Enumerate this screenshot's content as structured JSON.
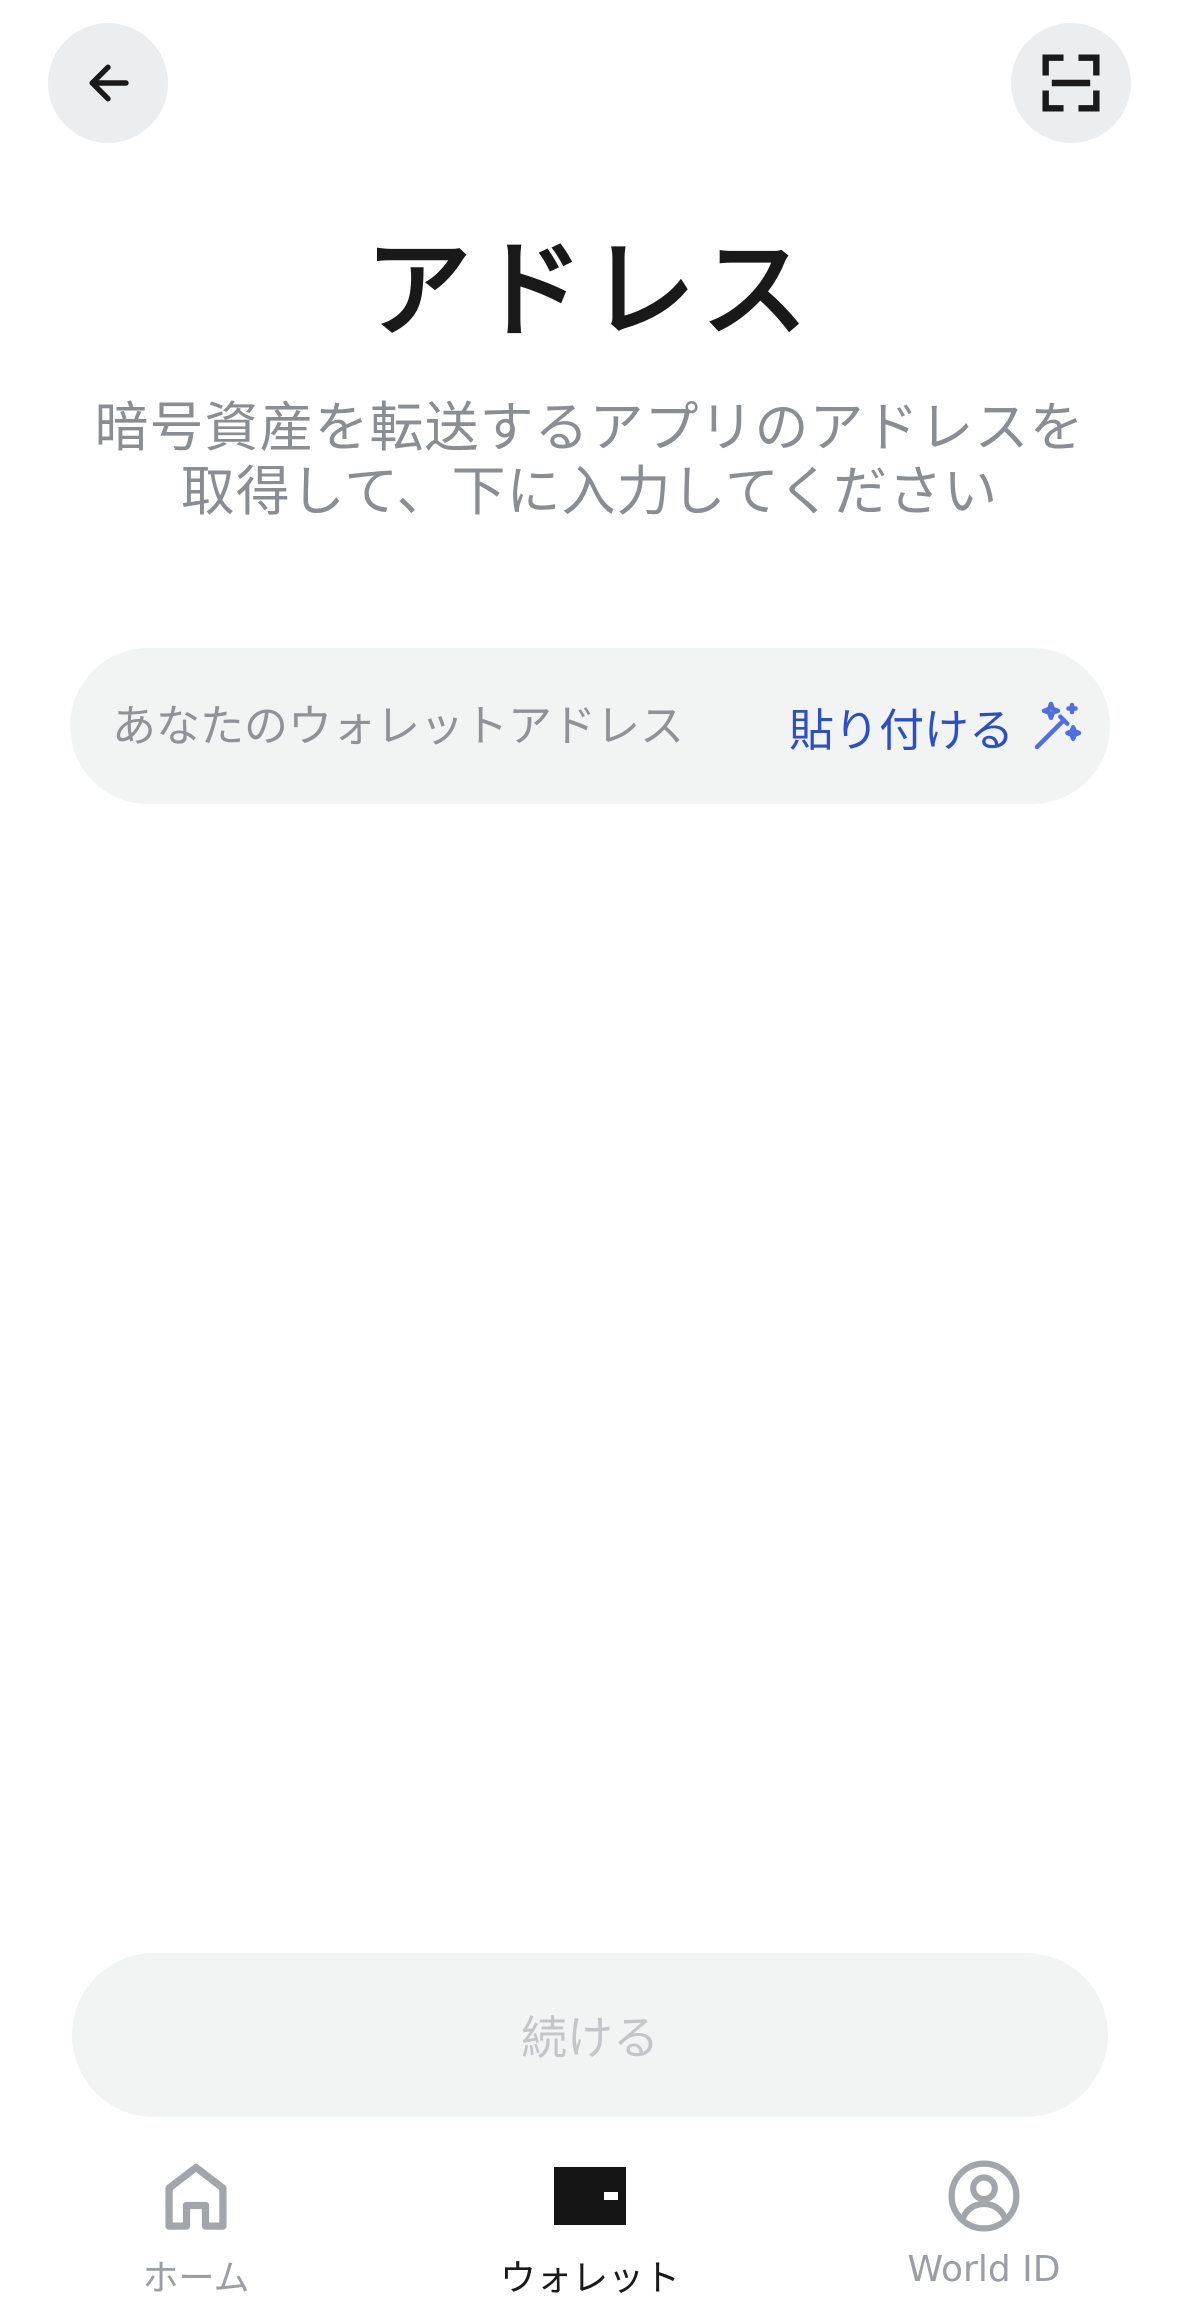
{
  "header": {
    "back_icon": "arrow-left-icon",
    "scan_icon": "scan-frame-icon"
  },
  "page": {
    "title": "アドレス",
    "subtitle_line1": "暗号資産を転送するアプリのアドレスを",
    "subtitle_line2": "取得して、下に入力してください"
  },
  "address_input": {
    "value": "",
    "placeholder": "あなたのウォレットアドレス",
    "paste_label": "貼り付ける",
    "paste_icon": "magic-wand-icon",
    "accent_color": "#2a4fc8"
  },
  "continue_button": {
    "label": "続ける",
    "disabled": true
  },
  "tabbar": {
    "active": "wallet",
    "items": [
      {
        "id": "home",
        "label": "ホーム",
        "icon": "home-icon"
      },
      {
        "id": "wallet",
        "label": "ウォレット",
        "icon": "wallet-icon"
      },
      {
        "id": "worldid",
        "label": "World ID",
        "icon": "user-circle-icon"
      }
    ]
  }
}
